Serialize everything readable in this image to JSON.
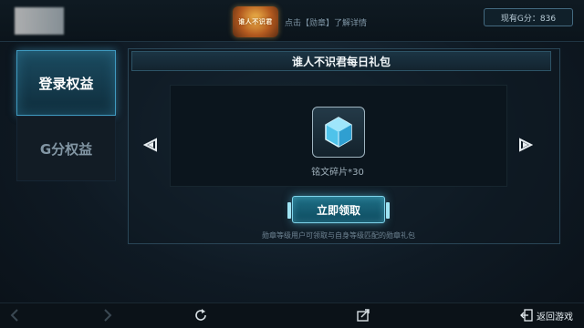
{
  "header": {
    "emblem_text": "谁人不识君",
    "detail_link": "点击【勋章】了解详情",
    "points": "现有G分：836"
  },
  "tabs": [
    {
      "label": "登录权益",
      "active": true
    },
    {
      "label": "G分权益",
      "active": false
    }
  ],
  "gift": {
    "title": "谁人不识君每日礼包",
    "item_icon": "crystal-gem-icon",
    "item_label": "铭文碎片*30",
    "claim_label": "立即领取",
    "note": "勋章等级用户可领取与自身等级匹配的勋章礼包"
  },
  "bottom": {
    "return_label": "返回游戏"
  },
  "colors": {
    "accent": "#3f9ac0",
    "button": "#1e6f86",
    "background": "#0f1a24"
  }
}
